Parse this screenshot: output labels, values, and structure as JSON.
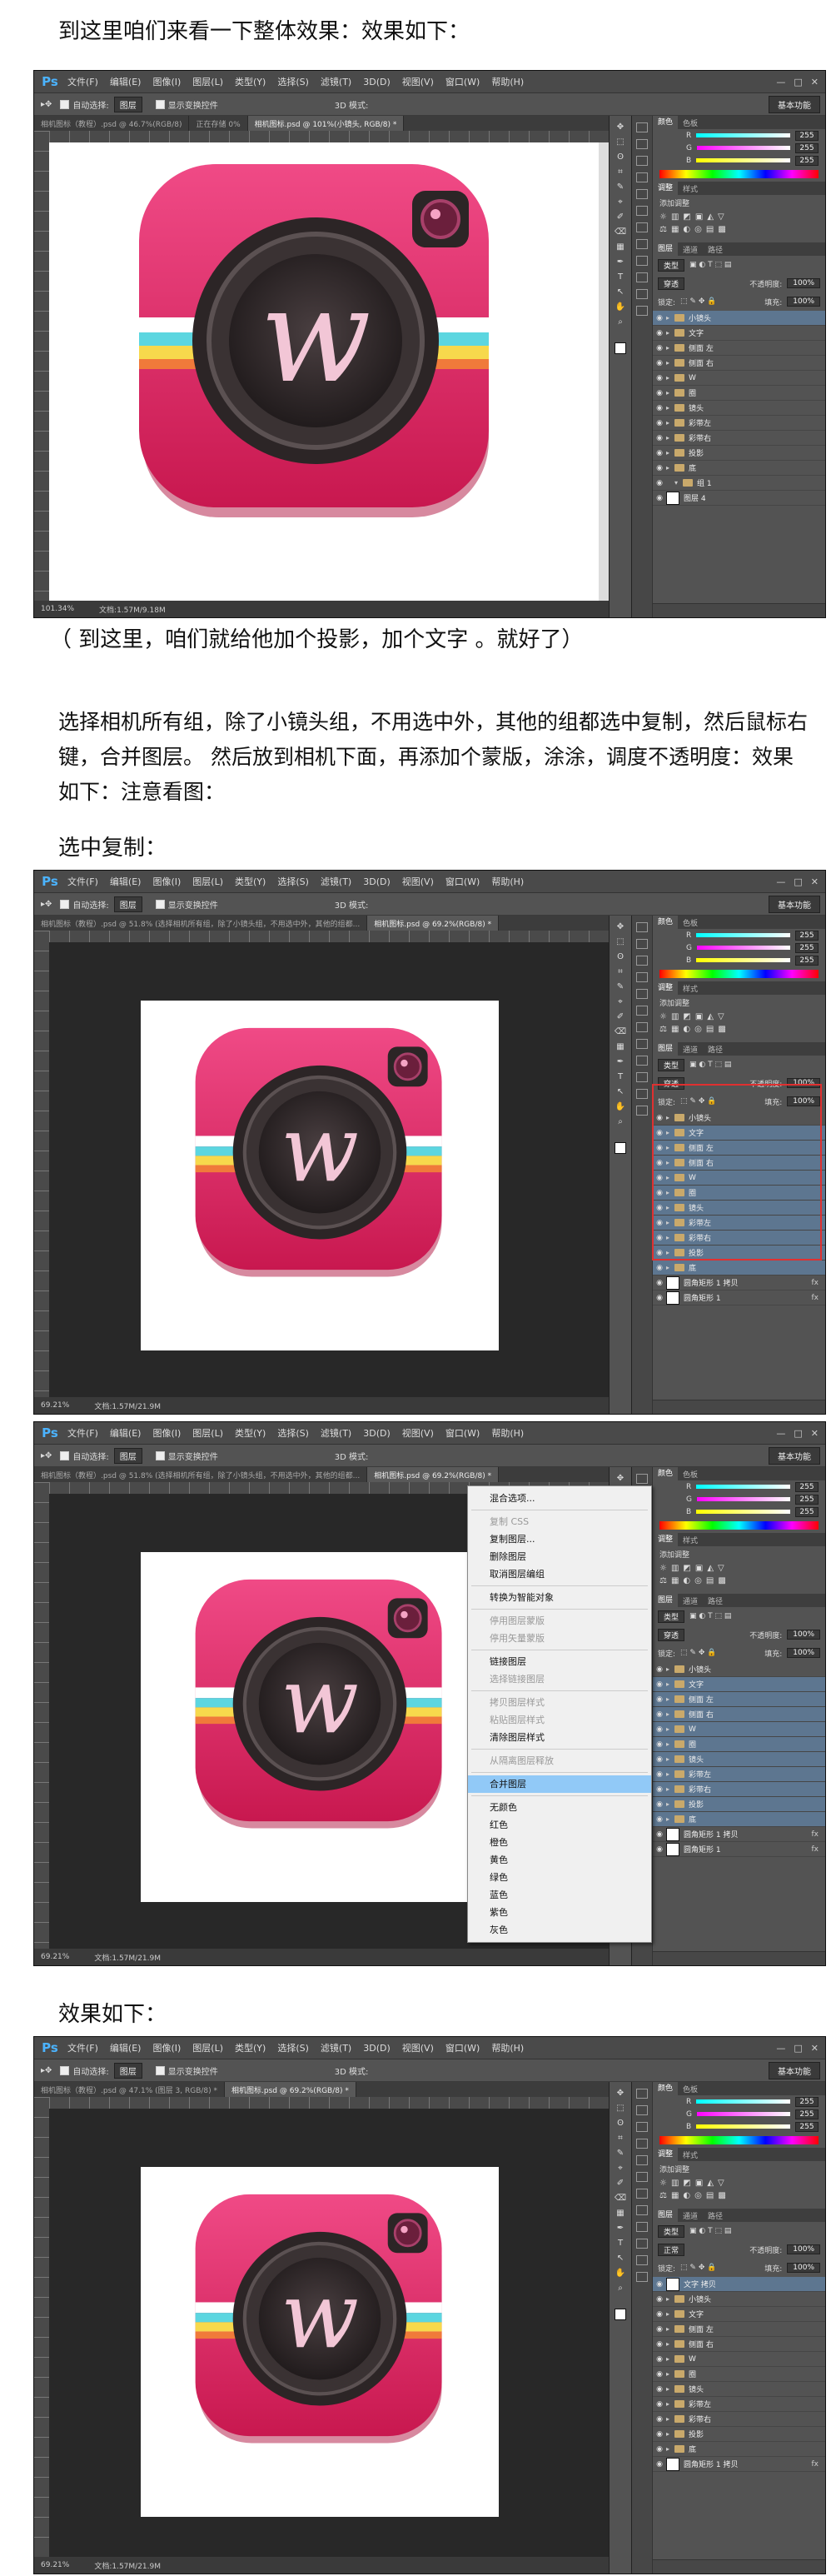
{
  "texts": {
    "heading1": "到这里咱们来看一下整体效果：效果如下：",
    "caption1": "（ 到这里，咱们就给他加个投影，加个文字 。就好了）",
    "para1": "选择相机所有组，除了小镜头组，不用选中外，其他的组都选中复制，然后鼠标右键，合并图层。 然后放到相机下面，再添加个蒙版，涂涂，调度不透明度：效果如下：注意看图：",
    "heading2": "选中复制：",
    "heading3": "效果如下："
  },
  "ps": {
    "logo": "Ps",
    "menus": [
      "文件(F)",
      "编辑(E)",
      "图像(I)",
      "图层(L)",
      "类型(Y)",
      "选择(S)",
      "滤镜(T)",
      "3D(D)",
      "视图(V)",
      "窗口(W)",
      "帮助(H)"
    ],
    "window_buttons": [
      "—",
      "□",
      "✕"
    ],
    "opt_autoselect": "自动选择:",
    "opt_layer": "图层",
    "opt_transform": "显示变换控件",
    "opt_3d": "3D 模式:",
    "workspace": "基本功能",
    "color_tabs": [
      "颜色",
      "色板"
    ],
    "color_channels": [
      {
        "label": "R",
        "value": "255"
      },
      {
        "label": "G",
        "value": "255"
      },
      {
        "label": "B",
        "value": "255"
      }
    ],
    "adj_tabs": [
      "调整",
      "样式"
    ],
    "adj_title": "添加调整",
    "layer_tabs": [
      "图层",
      "通道",
      "路径"
    ],
    "kind": "类型",
    "blend": "穿透",
    "opacity_label": "不透明度:",
    "opacity": "100%",
    "lock_label": "锁定:",
    "fill_label": "填充:",
    "fill": "100%",
    "normal": "正常"
  },
  "shot1": {
    "tabs": [
      "相机图标（教程）.psd @ 46.7%(RGB/8)",
      "正在存储 0%",
      "相机图标.psd @ 101%(小镜头, RGB/8) *"
    ],
    "status_zoom": "101.34%",
    "status_doc": "文档:1.57M/9.18M",
    "layers": [
      {
        "name": "小镜头",
        "type": "group",
        "selected": true
      },
      {
        "name": "文字",
        "type": "group"
      },
      {
        "name": "侧面 左",
        "type": "group"
      },
      {
        "name": "侧面 右",
        "type": "group"
      },
      {
        "name": "W",
        "type": "group"
      },
      {
        "name": "圈",
        "type": "group"
      },
      {
        "name": "镜头",
        "type": "group"
      },
      {
        "name": "彩带左",
        "type": "group"
      },
      {
        "name": "彩带右",
        "type": "group"
      },
      {
        "name": "投影",
        "type": "group"
      },
      {
        "name": "底",
        "type": "group"
      },
      {
        "name": "组 1",
        "type": "sub"
      },
      {
        "name": "图层 4",
        "type": "thumb"
      }
    ]
  },
  "shot2": {
    "tabs": [
      "相机图标（教程）.psd @ 51.8% (选择相机所有组，除了小镜头组，不用选中外，其他的组都...",
      "相机图标.psd @ 69.2%(RGB/8) *"
    ],
    "status_zoom": "69.21%",
    "status_doc": "文档:1.57M/21.9M",
    "layers": [
      {
        "name": "小镜头",
        "type": "group"
      },
      {
        "name": "文字",
        "type": "group",
        "selected": true
      },
      {
        "name": "侧面 左",
        "type": "group",
        "selected": true
      },
      {
        "name": "侧面 右",
        "type": "group",
        "selected": true
      },
      {
        "name": "W",
        "type": "group",
        "selected": true
      },
      {
        "name": "圈",
        "type": "group",
        "selected": true
      },
      {
        "name": "镜头",
        "type": "group",
        "selected": true
      },
      {
        "name": "彩带左",
        "type": "group",
        "selected": true
      },
      {
        "name": "彩带右",
        "type": "group",
        "selected": true
      },
      {
        "name": "投影",
        "type": "group",
        "selected": true
      },
      {
        "name": "底",
        "type": "group",
        "selected": true
      },
      {
        "name": "圆角矩形 1 拷贝",
        "type": "thumb",
        "fx": "fx"
      },
      {
        "name": "圆角矩形 1",
        "type": "thumb",
        "fx": "fx"
      }
    ]
  },
  "shot3": {
    "tabs": [
      "相机图标（教程）.psd @ 51.8% (选择相机所有组，除了小镜头组，不用选中外，其他的组都...",
      "相机图标.psd @ 69.2%(RGB/8) *"
    ],
    "status_zoom": "69.21%",
    "status_doc": "文档:1.57M/21.9M",
    "context_menu": [
      {
        "label": "混合选项...",
        "state": "normal"
      },
      {
        "sep": true
      },
      {
        "label": "复制 CSS",
        "state": "dis"
      },
      {
        "label": "复制图层...",
        "state": "normal"
      },
      {
        "label": "删除图层",
        "state": "normal"
      },
      {
        "label": "取消图层编组",
        "state": "normal"
      },
      {
        "sep": true
      },
      {
        "label": "转换为智能对象",
        "state": "normal"
      },
      {
        "sep": true
      },
      {
        "label": "停用图层蒙版",
        "state": "dis"
      },
      {
        "label": "停用矢量蒙版",
        "state": "dis"
      },
      {
        "sep": true
      },
      {
        "label": "链接图层",
        "state": "normal"
      },
      {
        "label": "选择链接图层",
        "state": "dis"
      },
      {
        "sep": true
      },
      {
        "label": "拷贝图层样式",
        "state": "dis"
      },
      {
        "label": "粘贴图层样式",
        "state": "dis"
      },
      {
        "label": "清除图层样式",
        "state": "normal"
      },
      {
        "sep": true
      },
      {
        "label": "从隔离图层释放",
        "state": "dis"
      },
      {
        "sep": true
      },
      {
        "label": "合并图层",
        "state": "hl"
      },
      {
        "sep": true
      },
      {
        "label": "无颜色",
        "state": "normal"
      },
      {
        "label": "红色",
        "state": "normal"
      },
      {
        "label": "橙色",
        "state": "normal"
      },
      {
        "label": "黄色",
        "state": "normal"
      },
      {
        "label": "绿色",
        "state": "normal"
      },
      {
        "label": "蓝色",
        "state": "normal"
      },
      {
        "label": "紫色",
        "state": "normal"
      },
      {
        "label": "灰色",
        "state": "normal"
      }
    ],
    "layers": [
      {
        "name": "小镜头",
        "type": "group"
      },
      {
        "name": "文字",
        "type": "group",
        "selected": true
      },
      {
        "name": "侧面 左",
        "type": "group",
        "selected": true
      },
      {
        "name": "侧面 右",
        "type": "group",
        "selected": true
      },
      {
        "name": "W",
        "type": "group",
        "selected": true
      },
      {
        "name": "圈",
        "type": "group",
        "selected": true
      },
      {
        "name": "镜头",
        "type": "group",
        "selected": true
      },
      {
        "name": "彩带左",
        "type": "group",
        "selected": true
      },
      {
        "name": "彩带右",
        "type": "group",
        "selected": true
      },
      {
        "name": "投影",
        "type": "group",
        "selected": true
      },
      {
        "name": "底",
        "type": "group",
        "selected": true
      },
      {
        "name": "圆角矩形 1 拷贝",
        "type": "thumb",
        "fx": "fx"
      },
      {
        "name": "圆角矩形 1",
        "type": "thumb",
        "fx": "fx"
      }
    ]
  },
  "shot4": {
    "tabs": [
      "相机图标（教程）.psd @ 47.1% (图层 3, RGB/8) *",
      "相机图标.psd @ 69.2%(RGB/8) *"
    ],
    "status_zoom": "69.21%",
    "status_doc": "文档:1.57M/21.9M",
    "layers": [
      {
        "name": "文字 拷贝",
        "type": "thumb",
        "selected": true
      },
      {
        "name": "小镜头",
        "type": "group"
      },
      {
        "name": "文字",
        "type": "group"
      },
      {
        "name": "侧面 左",
        "type": "group"
      },
      {
        "name": "侧面 右",
        "type": "group"
      },
      {
        "name": "W",
        "type": "group"
      },
      {
        "name": "圈",
        "type": "group"
      },
      {
        "name": "镜头",
        "type": "group"
      },
      {
        "name": "彩带左",
        "type": "group"
      },
      {
        "name": "彩带右",
        "type": "group"
      },
      {
        "name": "投影",
        "type": "group"
      },
      {
        "name": "底",
        "type": "group"
      },
      {
        "name": "圆角矩形 1 拷贝",
        "type": "thumb",
        "fx": "fx"
      }
    ]
  },
  "colors": {
    "icon_pink": "#e8336f",
    "icon_pink_dark": "#c8184f",
    "lens_dark": "#2c2526",
    "w_letter": "#f2c6d6",
    "layer_selected": "#5d7690",
    "highlight": "#91c9f7",
    "red_box": "#e03030"
  },
  "icons": [
    "ps-logo",
    "move-tool",
    "marquee-tool",
    "lasso-tool",
    "crop-tool",
    "eyedropper-tool",
    "brush-tool",
    "eraser-tool",
    "gradient-tool",
    "pen-tool",
    "type-tool",
    "hand-tool",
    "zoom-tool",
    "eye-icon",
    "folder-icon"
  ]
}
